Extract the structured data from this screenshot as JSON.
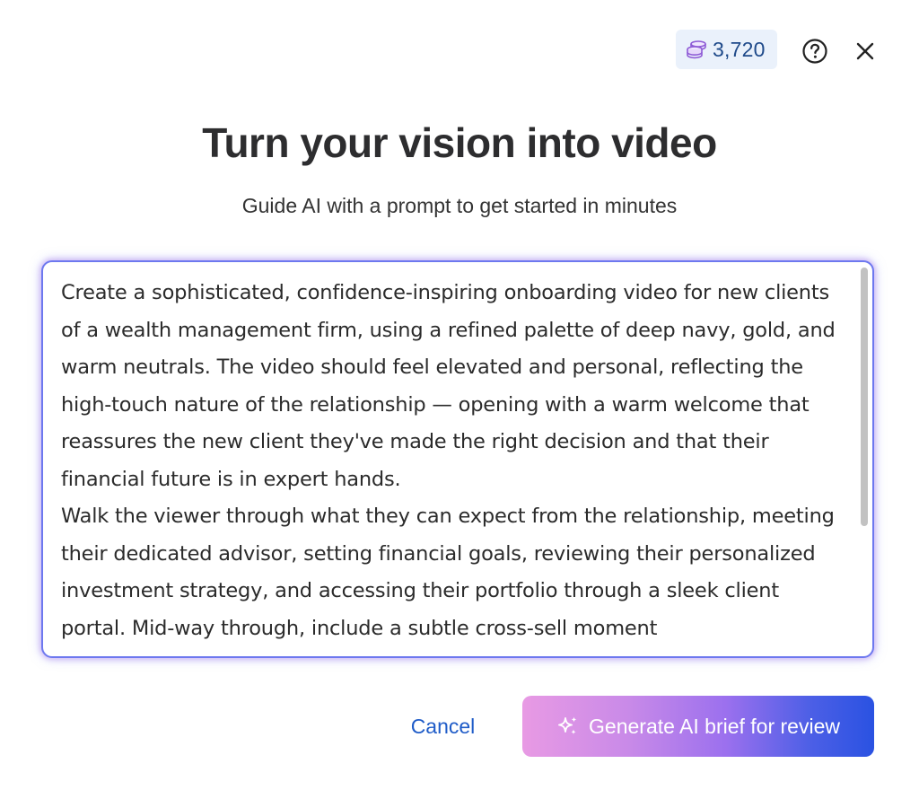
{
  "header": {
    "credits_value": "3,720",
    "credits_icon": "coins-stack-icon",
    "help_icon": "help-circle-icon",
    "close_icon": "close-icon"
  },
  "main": {
    "title": "Turn your vision into video",
    "subtitle": "Guide AI with a prompt to get started in minutes",
    "prompt_text": "Create a sophisticated, confidence-inspiring onboarding video for new clients of a wealth management firm, using a refined palette of deep navy, gold, and warm neutrals. The video should feel elevated and personal, reflecting the high-touch nature of the relationship — opening with a warm welcome that reassures the new client they've made the right decision and that their financial future is in expert hands.\nWalk the viewer through what they can expect from the relationship, meeting their dedicated advisor, setting financial goals, reviewing their personalized investment strategy, and accessing their portfolio through a sleek client portal. Mid-way through, include a subtle cross-sell moment"
  },
  "footer": {
    "cancel_label": "Cancel",
    "generate_label": "Generate AI brief for review",
    "generate_icon": "sparkles-icon"
  },
  "colors": {
    "accent_blue": "#1f5cc8",
    "credits_bg": "#eaf1fb",
    "focus_border": "#6d78ef",
    "gradient_start": "#e89ae4",
    "gradient_end": "#2a52e2"
  }
}
